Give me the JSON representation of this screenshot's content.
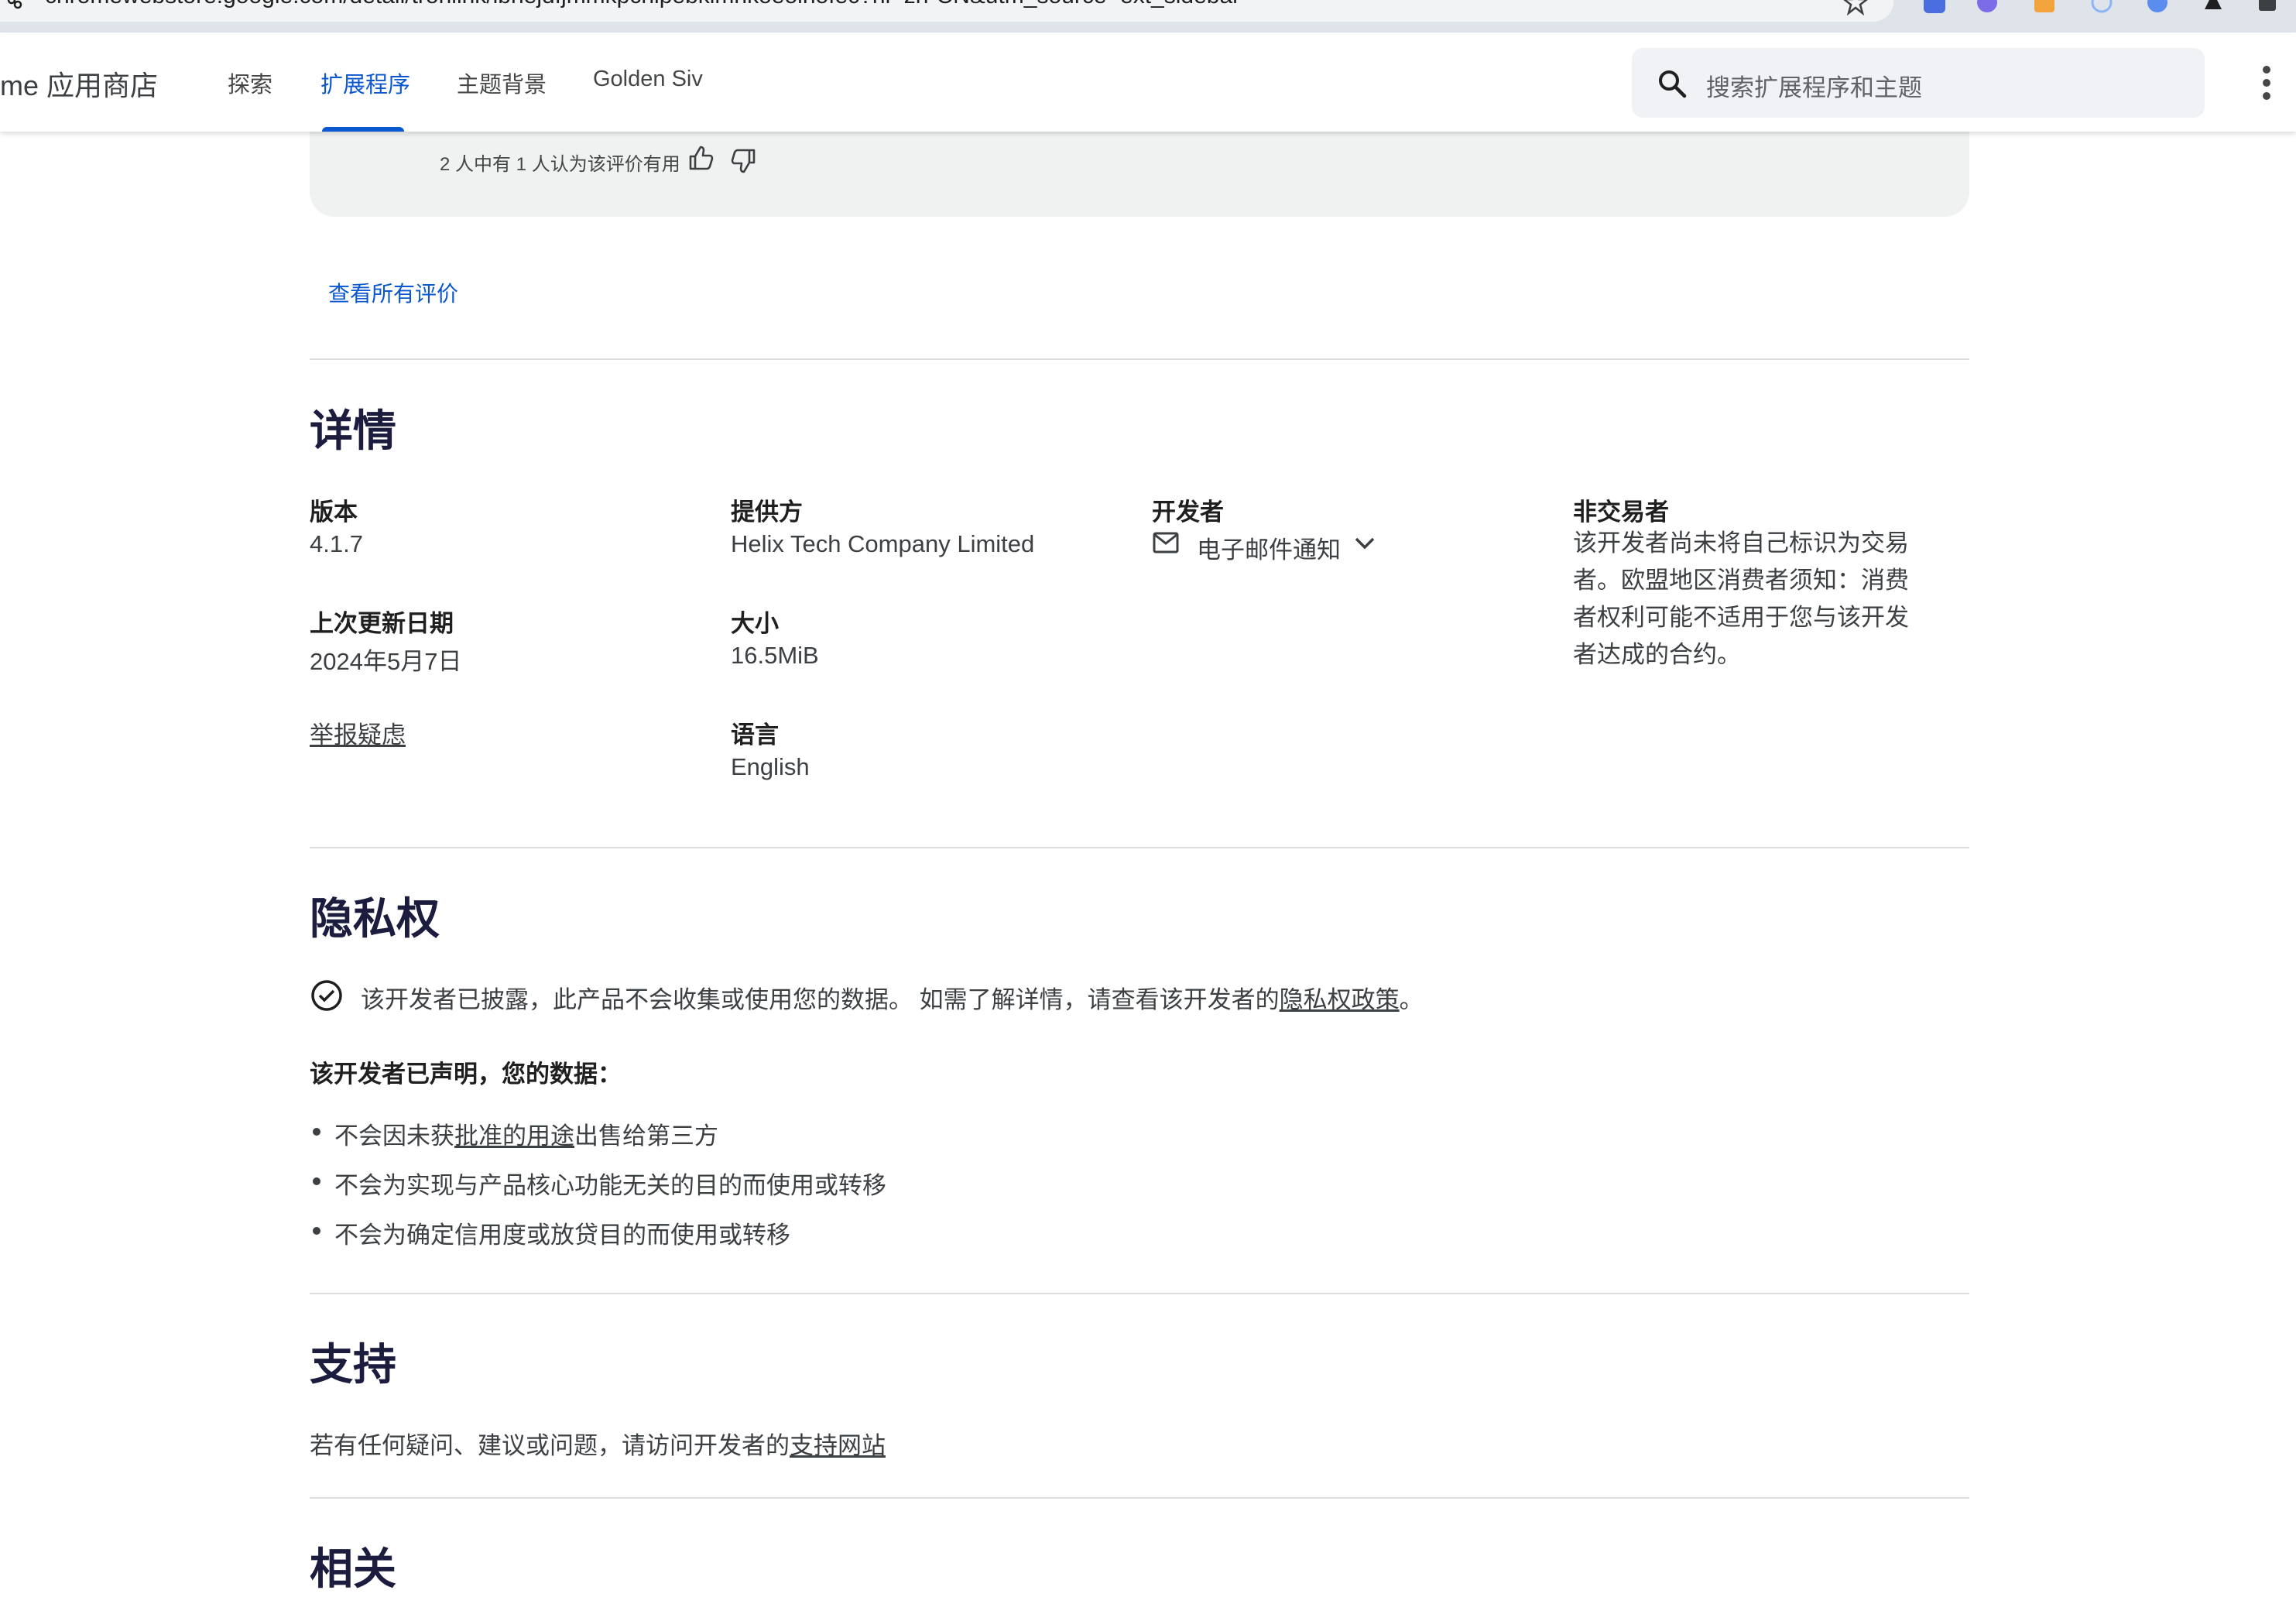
{
  "browser": {
    "url": "chromewebstore.google.com/detail/tronlink/ibnejdfjmmkpcnlpebklmnkoeoihofec?hl=zh-CN&utm_source=ext_sidebar"
  },
  "header": {
    "store_title": "me 应用商店",
    "tabs": [
      {
        "label": "探索"
      },
      {
        "label": "扩展程序"
      },
      {
        "label": "主题背景"
      },
      {
        "label": "Golden Siv"
      }
    ],
    "active_tab": "扩展程序",
    "search_placeholder": "搜索扩展程序和主题"
  },
  "review": {
    "helpful_text": "2 人中有 1 人认为该评价有用",
    "see_all_label": "查看所有评价"
  },
  "details": {
    "title": "详情",
    "version_label": "版本",
    "version_value": "4.1.7",
    "updated_label": "上次更新日期",
    "updated_value": "2024年5月7日",
    "report_label": "举报疑虑",
    "provider_label": "提供方",
    "provider_value": "Helix Tech Company Limited",
    "size_label": "大小",
    "size_value": "16.5MiB",
    "language_label": "语言",
    "language_value": "English",
    "developer_label": "开发者",
    "developer_email_label": "电子邮件通知",
    "trader_label": "非交易者",
    "trader_lines": [
      "该开发者尚未将自己标识为交易",
      "者。欧盟地区消费者须知：消费",
      "者权利可能不适用于您与该开发",
      "者达成的合约。"
    ]
  },
  "privacy": {
    "title": "隐私权",
    "disclosure_prefix": "该开发者已披露，此产品不会收集或使用您的数据。 如需了解详情，请查看该开发者的",
    "policy_link": "隐私权政策",
    "disclosure_suffix": "。",
    "declared_heading": "该开发者已声明，您的数据：",
    "item1_prefix": "不会因未获",
    "item1_link": "批准的用途",
    "item1_suffix": "出售给第三方",
    "item2": "不会为实现与产品核心功能无关的目的而使用或转移",
    "item3": "不会为确定信用度或放贷目的而使用或转移"
  },
  "support": {
    "title": "支持",
    "text_prefix": "若有任何疑问、建议或问题，请访问开发者的",
    "link": "支持网站"
  },
  "related": {
    "title": "相关"
  },
  "colors": {
    "accent": "#0b57d0",
    "heading": "#1b1c3e",
    "card_bg": "#f0f2f1",
    "search_bg": "#f0f2f5"
  }
}
